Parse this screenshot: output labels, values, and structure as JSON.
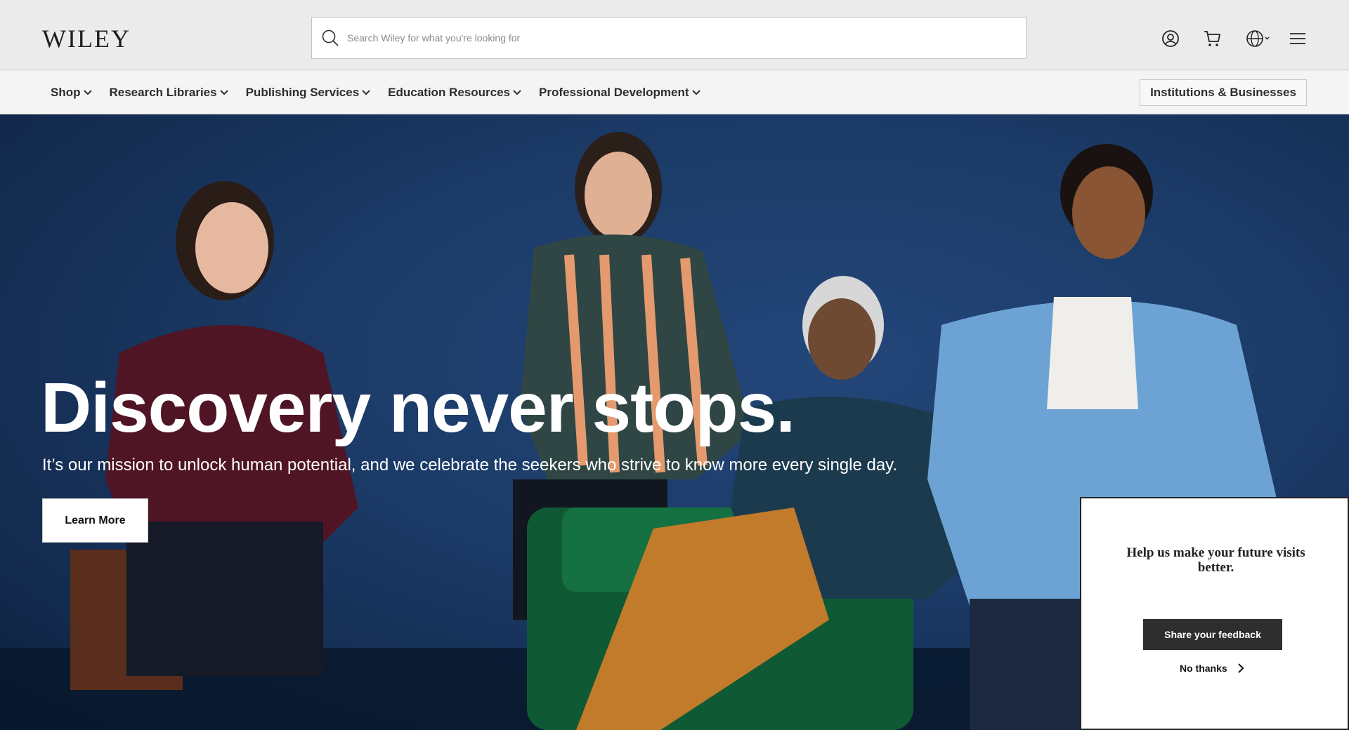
{
  "header": {
    "logo_text": "WILEY",
    "search_placeholder": "Search Wiley for what you're looking for",
    "icons": [
      "account-icon",
      "cart-icon",
      "globe-icon",
      "menu-icon"
    ]
  },
  "nav": {
    "items": [
      {
        "label": "Shop"
      },
      {
        "label": "Research Libraries"
      },
      {
        "label": "Publishing Services"
      },
      {
        "label": "Education Resources"
      },
      {
        "label": "Professional Development"
      }
    ],
    "institutions_label": "Institutions & Businesses"
  },
  "hero": {
    "title": "Discovery never stops.",
    "subtitle": "It’s our mission to unlock human potential, and we celebrate the seekers who strive to know more every single day.",
    "cta_label": "Learn More"
  },
  "feedback": {
    "message": "Help us make your future visits better.",
    "share_label": "Share your feedback",
    "no_thanks_label": "No thanks"
  },
  "colors": {
    "hero_background": "#1b3a66",
    "nav_background": "#f4f4f4",
    "header_background": "#ebebeb",
    "feedback_button": "#2e2e2e"
  }
}
